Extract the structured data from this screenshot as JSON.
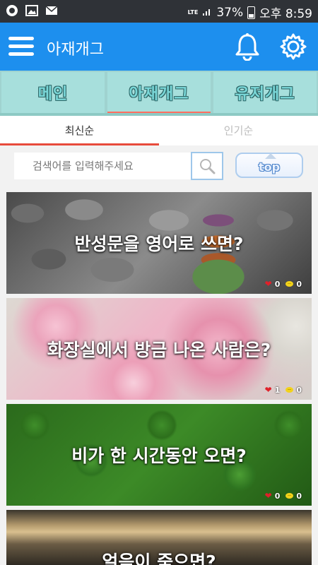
{
  "status_bar": {
    "network": "LTE",
    "battery_percent": "37%",
    "time": "오후 8:59",
    "left_icons": [
      "app-notification-icon",
      "image-icon",
      "mail-icon"
    ]
  },
  "header": {
    "title": "아재개그"
  },
  "category_tabs": [
    {
      "label": "메인"
    },
    {
      "label": "아재개그"
    },
    {
      "label": "유저개그"
    }
  ],
  "sort_tabs": [
    {
      "label": "최신순"
    },
    {
      "label": "인기순"
    }
  ],
  "search": {
    "placeholder": "검색어를 입력해주세요",
    "top_label": "top"
  },
  "colors": {
    "appbar": "#1d8fee",
    "category_bg": "#a7dfdc",
    "active_sort_underline": "#e84b3c",
    "like_heart": "#e0202a",
    "comment_bubble": "#f2d21b"
  },
  "posts": [
    {
      "title": "반성문을 영어로 쓰면?",
      "likes": "0",
      "comments": "0"
    },
    {
      "title": "화장실에서 방금 나온 사람은?",
      "likes": "1",
      "comments": "0"
    },
    {
      "title": "비가 한 시간동안 오면?",
      "likes": "0",
      "comments": "0"
    },
    {
      "title": "얼음이 죽으면?"
    }
  ]
}
